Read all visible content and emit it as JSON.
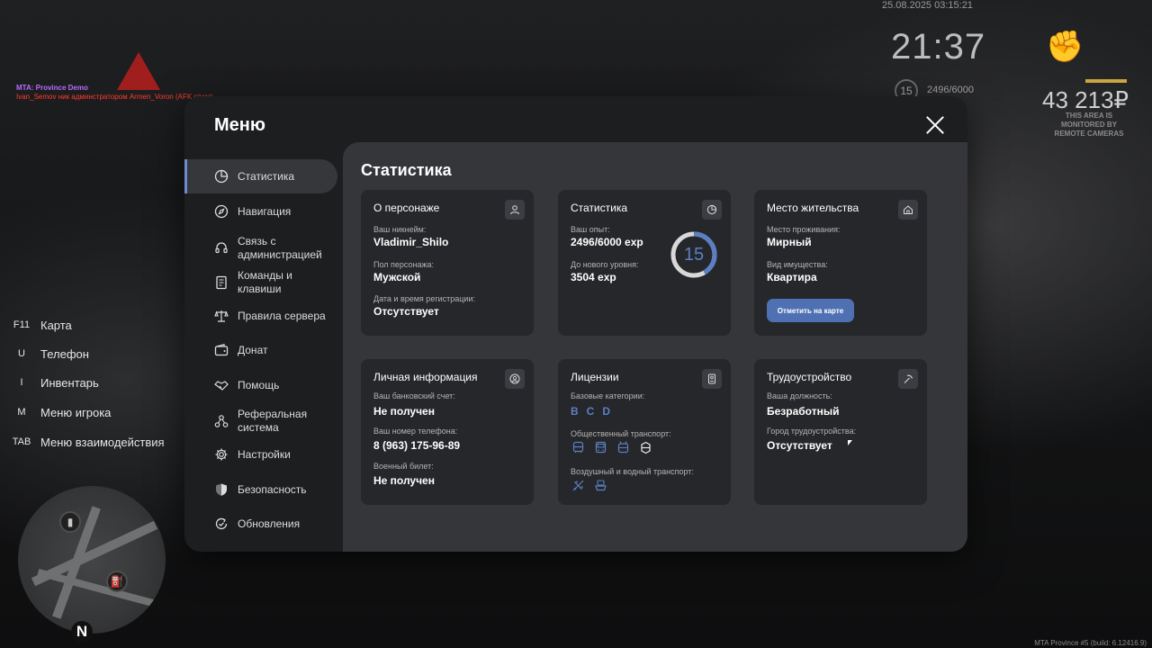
{
  "hud": {
    "datetime": "25.08.2025 03:15:21",
    "clock": "21:37",
    "level": "15",
    "exp": "2496/6000",
    "money": "43 213₽",
    "camera_sign": "THIS AREA IS MONITORED BY REMOTE CAMERAS",
    "server_name": "MTA: Province Demo",
    "server_message": "Ivan_Semov ник админстратором Armen_Voron (AFK спам)",
    "build_info": "MTA Province #5 (build: 6.12416.9)"
  },
  "keybinds": [
    {
      "key": "F11",
      "label": "Карта"
    },
    {
      "key": "U",
      "label": "Телефон"
    },
    {
      "key": "I",
      "label": "Инвентарь"
    },
    {
      "key": "M",
      "label": "Меню игрока"
    },
    {
      "key": "TAB",
      "label": "Меню взаимодействия"
    }
  ],
  "minimap": {
    "north": "N"
  },
  "menu": {
    "title": "Меню",
    "nav": [
      {
        "label": "Статистика",
        "icon": "pie-chart-icon",
        "active": true
      },
      {
        "label": "Навигация",
        "icon": "compass-icon"
      },
      {
        "label": "Связь с администрацией",
        "icon": "headset-icon"
      },
      {
        "label": "Команды и клавиши",
        "icon": "document-icon"
      },
      {
        "label": "Правила сервера",
        "icon": "scales-icon"
      },
      {
        "label": "Донат",
        "icon": "wallet-icon"
      },
      {
        "label": "Помощь",
        "icon": "handshake-icon"
      },
      {
        "label": "Реферальная система",
        "icon": "network-icon"
      },
      {
        "label": "Настройки",
        "icon": "gear-icon"
      },
      {
        "label": "Безопасность",
        "icon": "shield-icon"
      },
      {
        "label": "Обновления",
        "icon": "refresh-check-icon"
      }
    ],
    "content_title": "Статистика",
    "cards": {
      "character": {
        "title": "О персонаже",
        "nickname_label": "Ваш никнейм:",
        "nickname": "Vladimir_Shilo",
        "gender_label": "Пол персонажа:",
        "gender": "Мужской",
        "reg_label": "Дата и время регистрации:",
        "reg": "Отсутствует"
      },
      "stats": {
        "title": "Статистика",
        "exp_label": "Ваш опыт:",
        "exp": "2496/6000 exp",
        "next_label": "До нового уровня:",
        "next": "3504 exp",
        "level": "15",
        "progress": 0.416,
        "ring_color": "#5b7fc4"
      },
      "residence": {
        "title": "Место жительства",
        "place_label": "Место проживания:",
        "place": "Мирный",
        "property_label": "Вид имущества:",
        "property": "Квартира",
        "button": "Отметить на карте"
      },
      "personal": {
        "title": "Личная информация",
        "bank_label": "Ваш банковский счет:",
        "bank": "Не получен",
        "phone_label": "Ваш номер телефона:",
        "phone": "8 (963) 175-96-89",
        "military_label": "Военный билет:",
        "military": "Не получен"
      },
      "licenses": {
        "title": "Лицензии",
        "base_label": "Базовые категории:",
        "categories": [
          "B",
          "C",
          "D"
        ],
        "public_label": "Общественный транспорт:",
        "public_icons": [
          "bus-icon",
          "bus-front-icon",
          "trolleybus-icon",
          "tram-icon"
        ],
        "air_label": "Воздушный и водный транспорт:",
        "air_icons": [
          "airplane-icon",
          "boat-icon"
        ]
      },
      "employment": {
        "title": "Трудоустройство",
        "position_label": "Ваша должность:",
        "position": "Безработный",
        "city_label": "Город трудоустройства:",
        "city": "Отсутствует"
      }
    }
  },
  "colors": {
    "accent": "#5b7fc4",
    "button": "#4f71b3",
    "panel": "#35363a",
    "card": "#26272a",
    "window": "#1d1e20"
  }
}
